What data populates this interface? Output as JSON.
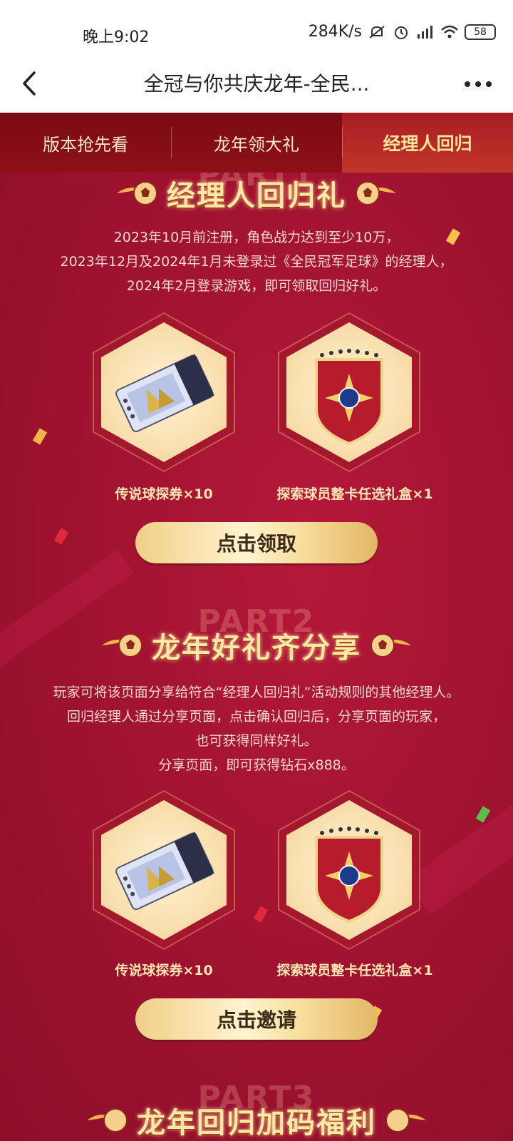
{
  "status_bar": {
    "time": "晚上9:02",
    "network_speed": "284K/s",
    "battery": "58"
  },
  "nav": {
    "title": "全冠与你共庆龙年-全民..."
  },
  "tabs": [
    {
      "label": "版本抢先看",
      "active": false
    },
    {
      "label": "龙年领大礼",
      "active": false
    },
    {
      "label": "经理人回归",
      "active": true
    }
  ],
  "sections": [
    {
      "ghost": "PART1",
      "title": "经理人回归礼",
      "description": [
        "2023年10月前注册，角色战力达到至少10万，",
        "2023年12月及2024年1月未登录过《全民冠军足球》的经理人，",
        "2024年2月登录游戏，即可领取回归好礼。"
      ],
      "rewards": [
        {
          "label": "传说球探券×10",
          "icon": "legend-ticket-icon"
        },
        {
          "label": "探索球员整卡任选礼盒×1",
          "icon": "ex-badge-icon"
        }
      ],
      "button": "点击领取"
    },
    {
      "ghost": "PART2",
      "title": "龙年好礼齐分享",
      "description": [
        "玩家可将该页面分享给符合“经理人回归礼”活动规则的其他经理人。",
        "回归经理人通过分享页面，点击确认回归后，分享页面的玩家，",
        "也可获得同样好礼。",
        "分享页面，即可获得钻石x888。"
      ],
      "rewards": [
        {
          "label": "传说球探券×10",
          "icon": "legend-ticket-icon"
        },
        {
          "label": "探索球员整卡任选礼盒×1",
          "icon": "ex-badge-icon"
        }
      ],
      "button": "点击邀请"
    },
    {
      "ghost": "PART3",
      "title": "龙年回归加码福利"
    }
  ],
  "colors": {
    "tab_bg": "#7a0b14",
    "tab_active": "#c2352b",
    "content_bg": "#a41432",
    "title_gold": "#ffe8a8",
    "button_gold": "#f0cf86"
  }
}
